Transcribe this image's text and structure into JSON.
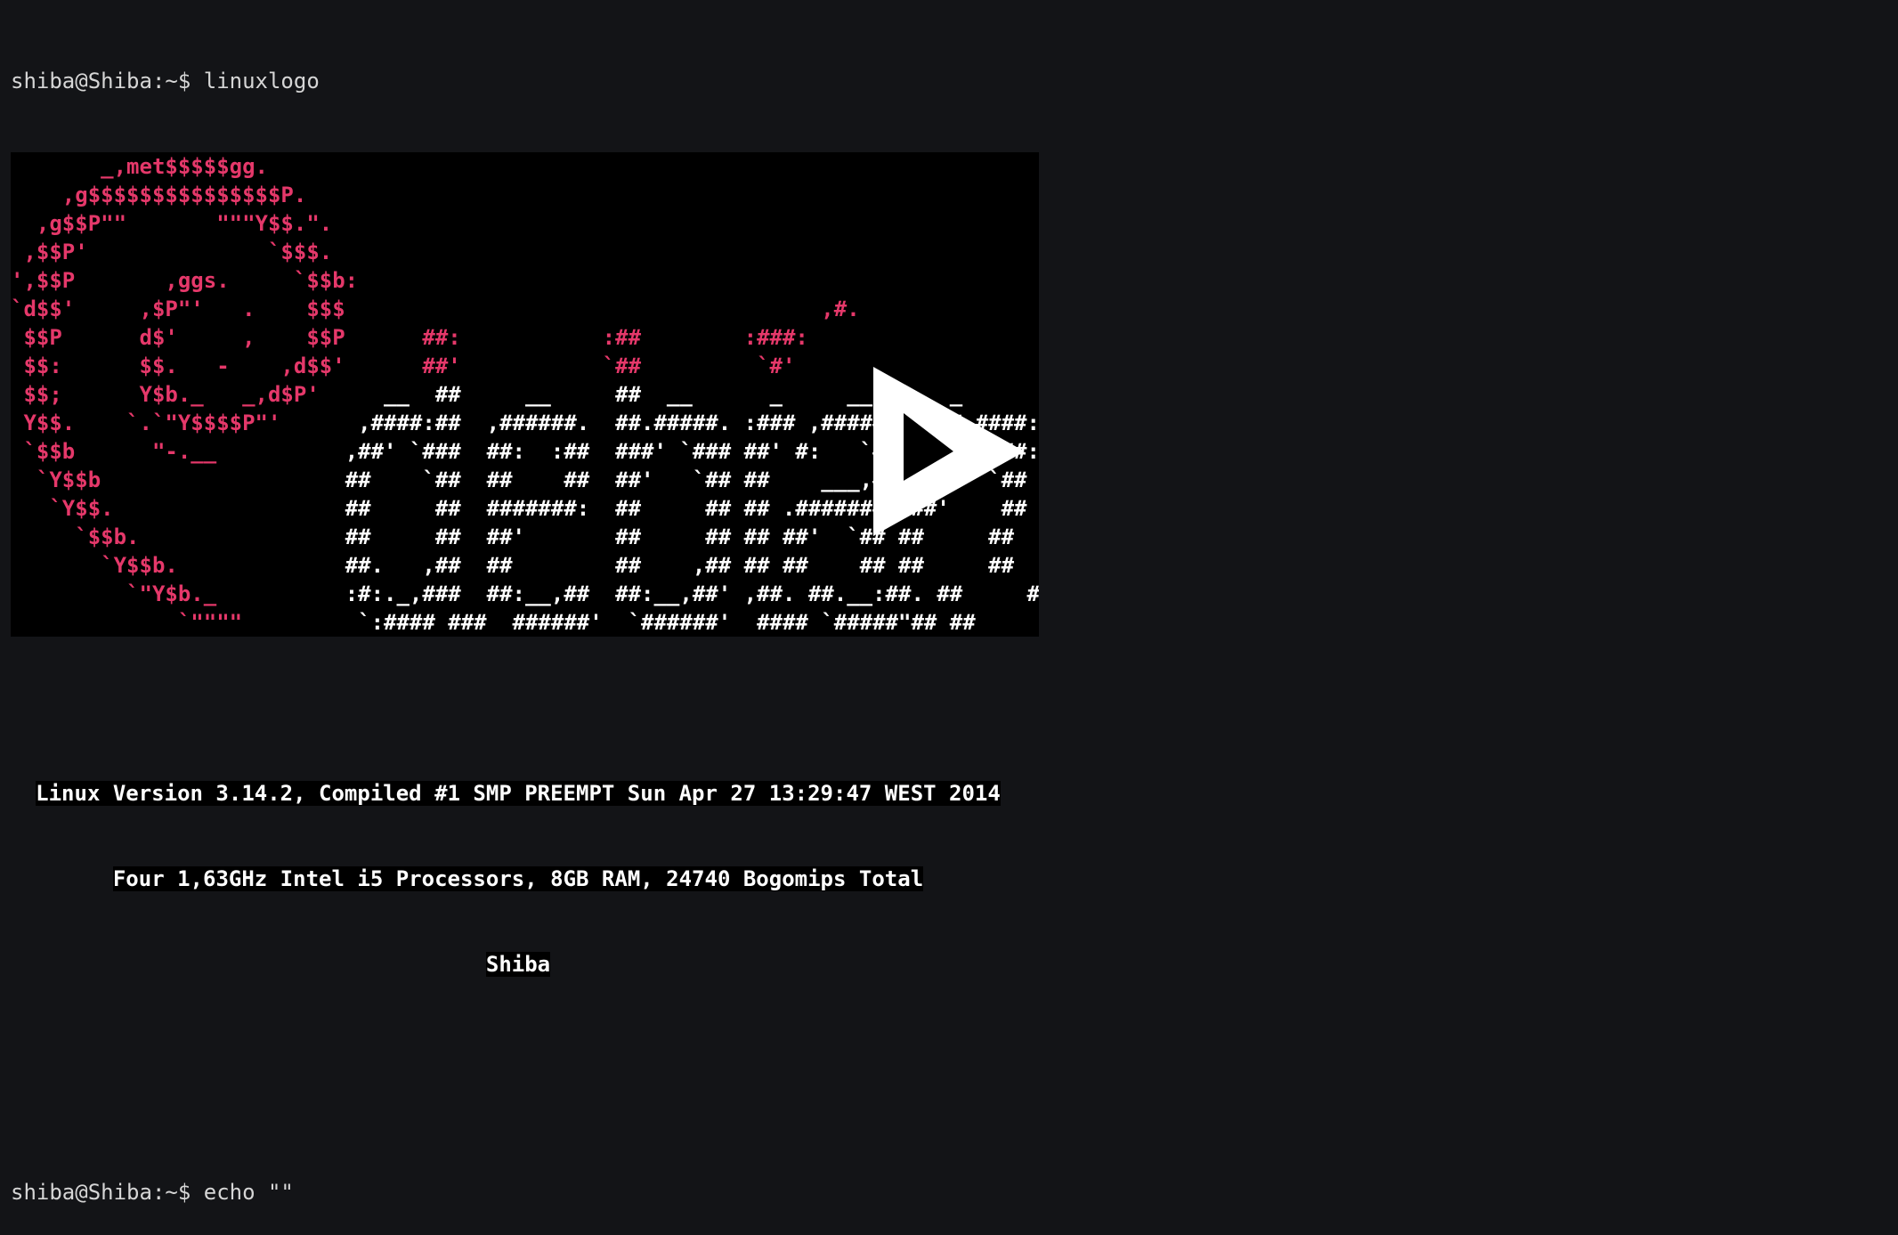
{
  "terminal": {
    "prompt1": "shiba@Shiba:~$ linuxlogo",
    "prompt2": "shiba@Shiba:~$ echo \"\""
  },
  "logo": {
    "swirl_lines": [
      "       _,met$$$$$gg.",
      "    ,g$$$$$$$$$$$$$$$P.",
      "  ,g$$P\"\"       \"\"\"Y$$.\".",
      " ,$$P'              `$$$.",
      "',$$P       ,ggs.     `$$b:",
      "`d$$'     ,$P\"'   .    $$$",
      " $$P      d$'     ,    $$P",
      " $$:      $$.   -    ,d$$'",
      " $$;      Y$b._   _,d$P'",
      " Y$$.    `.`\"Y$$$$P\"'",
      " `$$b      \"-.__",
      "  `Y$$b",
      "   `Y$$.",
      "     `$$b.",
      "       `Y$$b.",
      "         `\"Y$b._",
      "             `\"\"\"\""
    ],
    "word_lines": [
      "",
      "",
      "",
      "",
      "",
      "                                     ,#.",
      "      ##:           :##        :###:",
      "      ##'           `##         `#'",
      "   __  ##     __     ##  __      _     __      _",
      " ,####:##  ,######.  ##.#####. :### ,######. ###.####:",
      ",##' `###  ##:  :##  ###' `### ##' #:   `## `###' `##:",
      "##    `##  ##    ##  ##'   `## ##    ___,## ##:   `##",
      "##     ##  #######:  ##     ## ## .######## ##'    ##",
      "##     ##  ##'       ##     ## ## ##'  `## ##     ##",
      "##.   ,##  ##        ##    ,## ## ##    ## ##     ##",
      ":#:._,###  ##:__,##  ##:__,##' ,##. ##.__:##. ##     ##",
      " `:#### ###  ######'  `######'  #### `#####\"## ##     ##"
    ]
  },
  "info": {
    "line1": "Linux Version 3.14.2, Compiled #1 SMP PREEMPT Sun Apr 27 13:29:47 WEST 2014",
    "line2": "Four 1,63GHz Intel i5 Processors, 8GB RAM, 24740 Bogomips Total",
    "line3": "Shiba"
  },
  "overlay": {
    "icon": "play-icon",
    "color": "#ffffff"
  }
}
